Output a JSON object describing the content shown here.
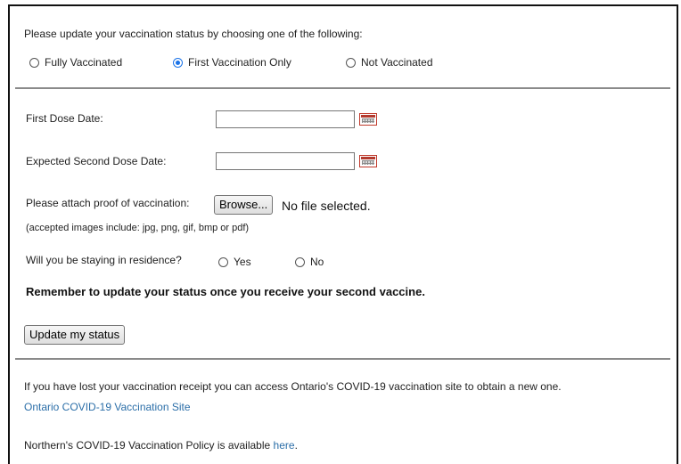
{
  "vaccination": {
    "prompt": "Please update your vaccination status by choosing one of the following:",
    "options": [
      {
        "label": "Fully Vaccinated",
        "checked": false
      },
      {
        "label": "First Vaccination Only",
        "checked": true
      },
      {
        "label": "Not Vaccinated",
        "checked": false
      }
    ]
  },
  "dates": {
    "first_dose_label": "First Dose Date:",
    "first_dose_value": "",
    "second_dose_label": "Expected Second Dose Date:",
    "second_dose_value": ""
  },
  "proof": {
    "label": "Please attach proof of vaccination:",
    "browse_label": "Browse...",
    "file_status": "No file selected.",
    "accepted_note": "(accepted images include: jpg, png, gif, bmp or pdf)"
  },
  "residence": {
    "question": "Will you be staying in residence?",
    "yes_label": "Yes",
    "no_label": "No"
  },
  "reminder": "Remember to update your status once you receive your second vaccine.",
  "update_button_label": "Update my status",
  "footer": {
    "lost_receipt_text": "If you have lost your vaccination receipt you can access Ontario's COVID-19 vaccination site to obtain a new one.",
    "ontario_link_label": "Ontario COVID-19 Vaccination Site",
    "policy_text": "Northern's COVID-19 Vaccination Policy is available",
    "policy_link_label": "here",
    "policy_period": "."
  },
  "colors": {
    "accent": "#1a73e8",
    "link": "#2b6ea8",
    "calendar_border": "#c0392b"
  }
}
